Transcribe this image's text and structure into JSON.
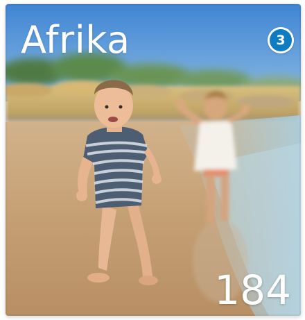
{
  "tile": {
    "title": "Afrika",
    "badge_number": "3",
    "count": "184",
    "photo_icon": "beach-children-photo"
  },
  "colors": {
    "badge_blue": "#0e7cc2",
    "text": "#ffffff",
    "sky": "#4f8fd6",
    "sand": "#c9a67a",
    "sea": "#9fc4d4"
  }
}
